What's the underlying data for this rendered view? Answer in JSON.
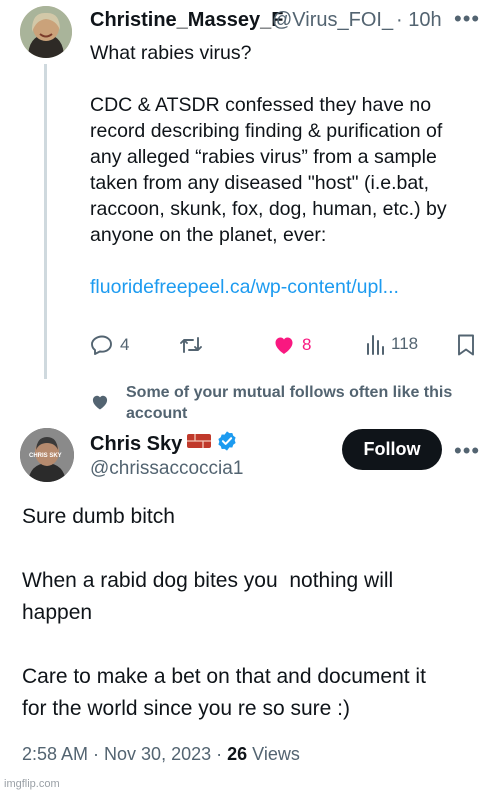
{
  "tweet1": {
    "author_name": "Christine_Massey_F",
    "author_handle": "@Virus_FOI_L",
    "separator": "·",
    "time": "10h",
    "more": "•••",
    "lines": [
      "What rabies virus?",
      "",
      "CDC & ATSDR confessed they have no",
      "record describing finding & purification of",
      "any alleged “rabies virus” from a sample",
      "taken from any diseased \"host\" (i.e.bat,",
      "raccoon, skunk, fox, dog, human, etc.) by",
      "anyone on the planet, ever:",
      ""
    ],
    "link_text": "fluoridefreepeel.ca/wp-content/upl...",
    "actions": {
      "replies": "4",
      "likes": "8",
      "views": "118"
    }
  },
  "social_context": {
    "text": "Some of your mutual follows often like this account"
  },
  "tweet2": {
    "author_name": "Chris Sky",
    "author_handle": "@chrissaccoccia1",
    "follow_label": "Follow",
    "more": "•••",
    "avatar_text": "CHRIS SKY",
    "lines": [
      "Sure dumb bitch",
      "",
      "When a rabid dog bites you  nothing will",
      "happen",
      "",
      "Care to make a bet on that and document it",
      "for the world since you re so sure :)"
    ],
    "timestamp": "2:58 AM · Nov 30, 2023 · ",
    "view_count": "26",
    "views_label": " Views"
  },
  "watermark": "imgflip.com",
  "colors": {
    "link": "#1d9bf0",
    "like": "#f91880",
    "muted": "#536471",
    "verified": "#1d9bf0",
    "button": "#0f1419"
  },
  "icons": [
    "reply-icon",
    "retweet-icon",
    "heart-icon",
    "views-icon",
    "bookmark-icon",
    "heart-social-icon",
    "verified-badge-icon",
    "brick-emoji-icon"
  ]
}
